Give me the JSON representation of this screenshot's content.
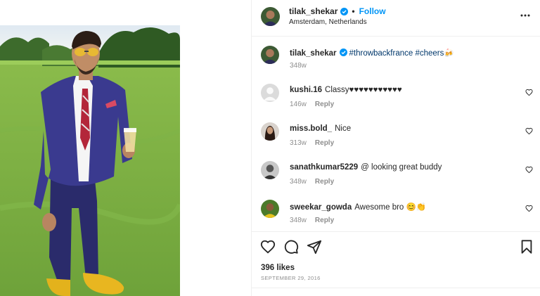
{
  "header": {
    "username": "tilak_shekar",
    "separator": "•",
    "follow_label": "Follow",
    "location": "Amsterdam, Netherlands"
  },
  "caption": {
    "username": "tilak_shekar",
    "text": "#throwbackfrance #cheers🍻",
    "time": "348w"
  },
  "comments": [
    {
      "username": "kushi.16",
      "text": "Classy♥♥♥♥♥♥♥♥♥♥♥",
      "time": "146w",
      "reply_label": "Reply"
    },
    {
      "username": "miss.bold_",
      "text": "Nice",
      "time": "313w",
      "reply_label": "Reply"
    },
    {
      "username": "sanathkumar5229",
      "text": "@ looking great buddy",
      "time": "348w",
      "reply_label": "Reply"
    },
    {
      "username": "sweekar_gowda",
      "text": "Awesome bro 😊👏",
      "time": "348w",
      "reply_label": "Reply"
    }
  ],
  "footer": {
    "likes": "396 likes",
    "date": "SEPTEMBER 29, 2016"
  },
  "icons": {
    "verified": "verified-badge-icon",
    "more": "more-options-icon",
    "like": "heart-icon",
    "comment": "comment-icon",
    "share": "share-icon",
    "save": "bookmark-icon"
  },
  "colors": {
    "accent": "#0095f6",
    "text": "#262626",
    "muted": "#8e8e8e",
    "border": "#efefef"
  }
}
